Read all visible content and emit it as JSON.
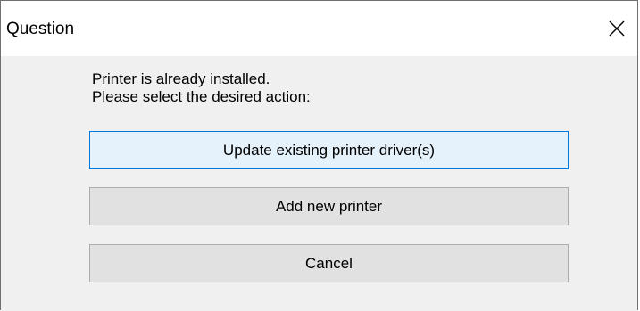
{
  "window": {
    "title": "Question",
    "close_icon": "close-x-icon"
  },
  "message": {
    "line1": "Printer is already installed.",
    "line2": "Please select the desired action:"
  },
  "buttons": {
    "update_label": "Update existing printer driver(s)",
    "add_label": "Add new printer",
    "cancel_label": "Cancel"
  },
  "colors": {
    "focused_border": "#0078d7",
    "focused_fill": "#e5f1fb",
    "button_fill": "#e1e1e1",
    "body_bg": "#f0f0f0"
  }
}
